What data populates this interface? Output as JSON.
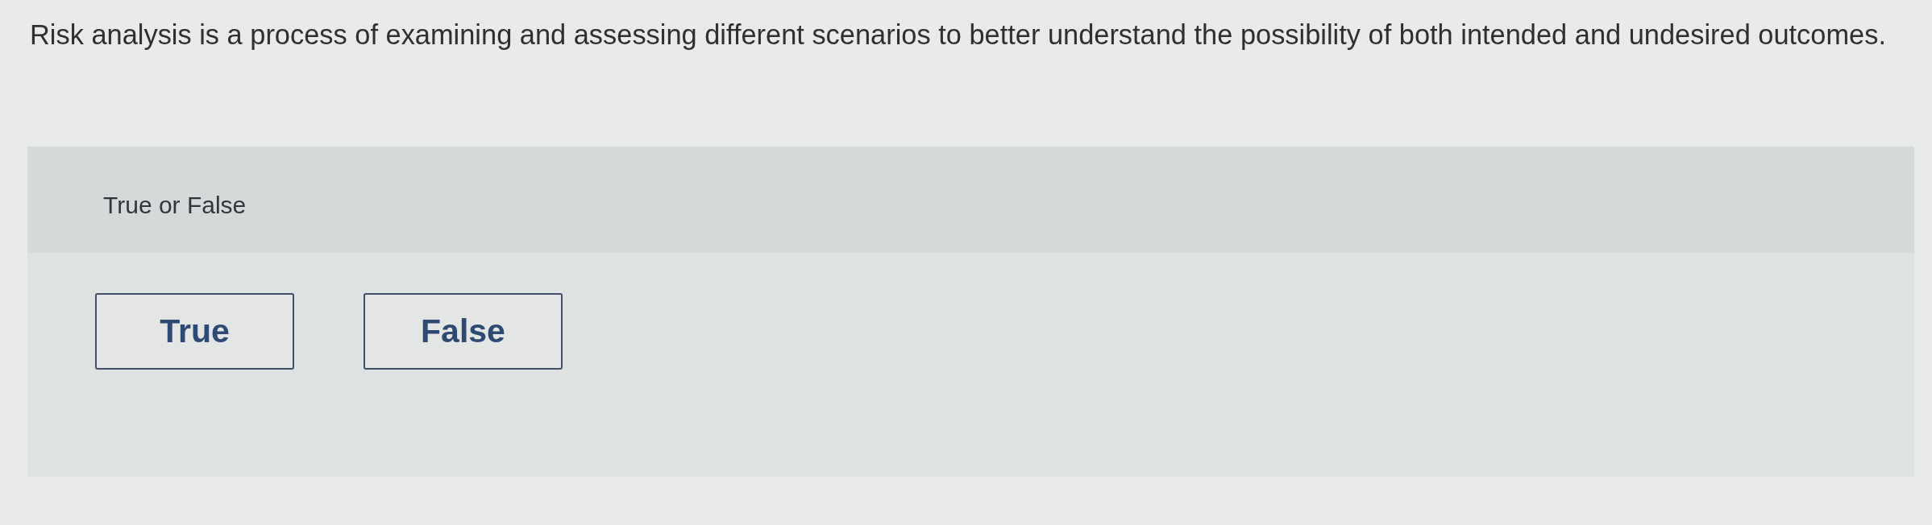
{
  "question": {
    "text": "Risk analysis is a process of examining and assessing different scenarios to better understand the possibility of both intended and undesired outcomes."
  },
  "answer_panel": {
    "prompt": "True or False",
    "options": [
      {
        "label": "True",
        "selected": false
      },
      {
        "label": "False",
        "selected": false
      }
    ]
  }
}
